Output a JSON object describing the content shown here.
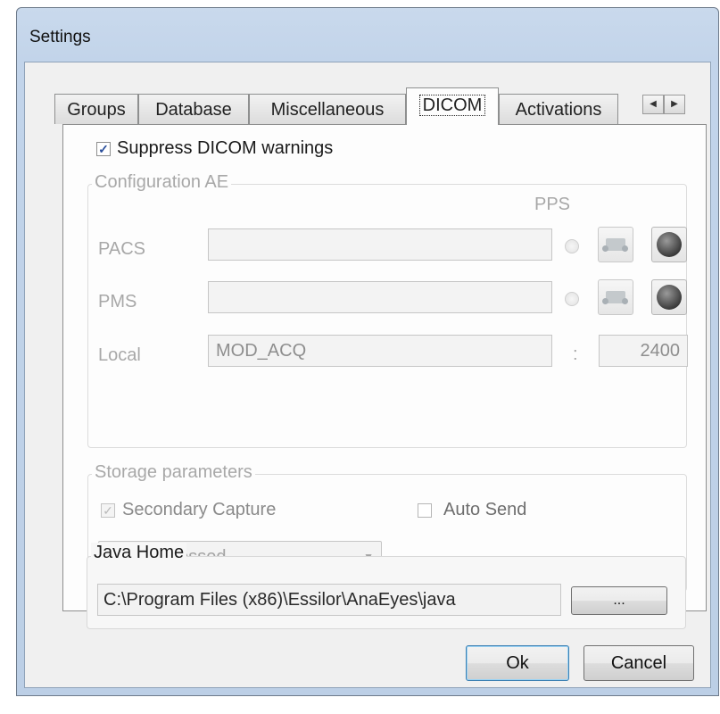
{
  "window": {
    "title": "Settings"
  },
  "tabs": [
    {
      "label": "Groups"
    },
    {
      "label": "Database"
    },
    {
      "label": "Miscellaneous"
    },
    {
      "label": "DICOM",
      "active": true
    },
    {
      "label": "Activations"
    }
  ],
  "tab_scroll": {
    "left_icon": "triangle-left-icon",
    "right_icon": "triangle-right-icon"
  },
  "dicom": {
    "suppress_warnings": {
      "label": "Suppress DICOM warnings",
      "checked": true
    },
    "config_ae": {
      "title": "Configuration AE",
      "pps_label": "PPS",
      "pacs": {
        "label": "PACS",
        "value": "",
        "pps_selected": false
      },
      "pms": {
        "label": "PMS",
        "value": "",
        "pps_selected": false
      },
      "local": {
        "label": "Local",
        "value": "MOD_ACQ",
        "separator": ":",
        "port": "2400"
      }
    },
    "storage": {
      "title": "Storage parameters",
      "secondary_capture": {
        "label": "Secondary Capture",
        "checked": true,
        "enabled": false
      },
      "auto_send": {
        "label": "Auto Send",
        "checked": false
      },
      "compression": {
        "selected": "Uncompressed"
      }
    },
    "java_home": {
      "title": "Java Home",
      "path": "C:\\Program Files (x86)\\Essilor\\AnaEyes\\java",
      "browse_label": "..."
    }
  },
  "footer": {
    "ok_label": "Ok",
    "cancel_label": "Cancel"
  },
  "colors": {
    "window_frame": "#c2d4ea",
    "panel_bg": "#fdfdfd",
    "dialog_bg": "#f0f0f0",
    "checkbox_check": "#2a4f9b"
  }
}
